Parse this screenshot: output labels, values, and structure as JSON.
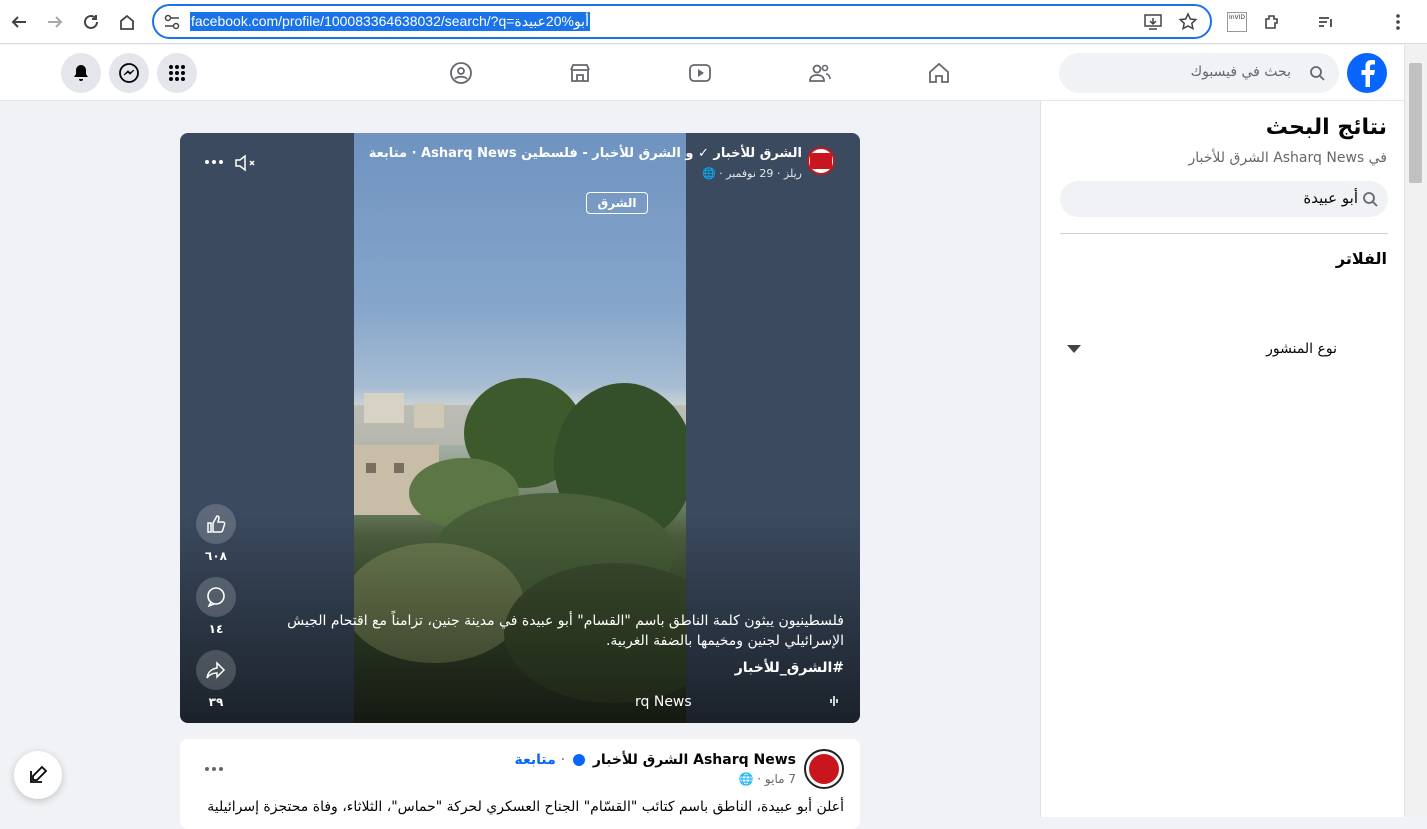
{
  "browser": {
    "url": "facebook.com/profile/100083364638032/search/?q=أبو%20عبيدة",
    "icons": [
      "back-icon",
      "forward-icon",
      "reload-icon",
      "home-icon",
      "site-settings-icon",
      "install-app-icon",
      "bookmark-star-icon",
      "invid-extension-icon",
      "extensions-icon",
      "reading-list-icon",
      "menu-icon"
    ],
    "invid_label": "InVID"
  },
  "fb_header": {
    "search_placeholder": "بحث في فيسبوك",
    "nav_icons": [
      "home-icon",
      "friends-icon",
      "video-icon",
      "marketplace-icon",
      "groups-icon"
    ],
    "right_buttons": [
      "menu-grid-icon",
      "messenger-icon",
      "notifications-icon"
    ],
    "brand_color": "#0866ff"
  },
  "search_panel": {
    "title": "نتائج البحث",
    "subtitle": "في Asharq News الشرق للأخبار",
    "query": "أبو عبيدة",
    "filters_label": "الفلاتر",
    "post_type_label": "نوع المنشور"
  },
  "video_post": {
    "header": "الشرق للأخبار ✓ و الشرق للأخبار - فلسطين Asharq News · متابعة",
    "meta": "ريلز · 29 نوفمبر · 🌐",
    "watermark": "الشرق",
    "caption": "فلسطينيون يبثون كلمة الناطق باسم \"القسام\" أبو عبيدة في مدينة جنين، تزامناً مع اقتحام الجيش الإسرائيلي لجنين ومخيمها بالضفة الغربية.",
    "hashtag": "#الشرق_للأخبار",
    "source_text": "rq News",
    "likes": "٦٠٨",
    "comments": "١٤",
    "shares": "٣٩"
  },
  "post2": {
    "name": "Asharq News الشرق للأخبار",
    "follow": "متابعة",
    "date": "7 مايو · 🌐",
    "text": "أعلن أبو عبيدة، الناطق باسم كتائب \"القسّام\" الجناح العسكري لحركة \"حماس\"، الثلاثاء، وفاة محتجزة إسرائيلية"
  }
}
